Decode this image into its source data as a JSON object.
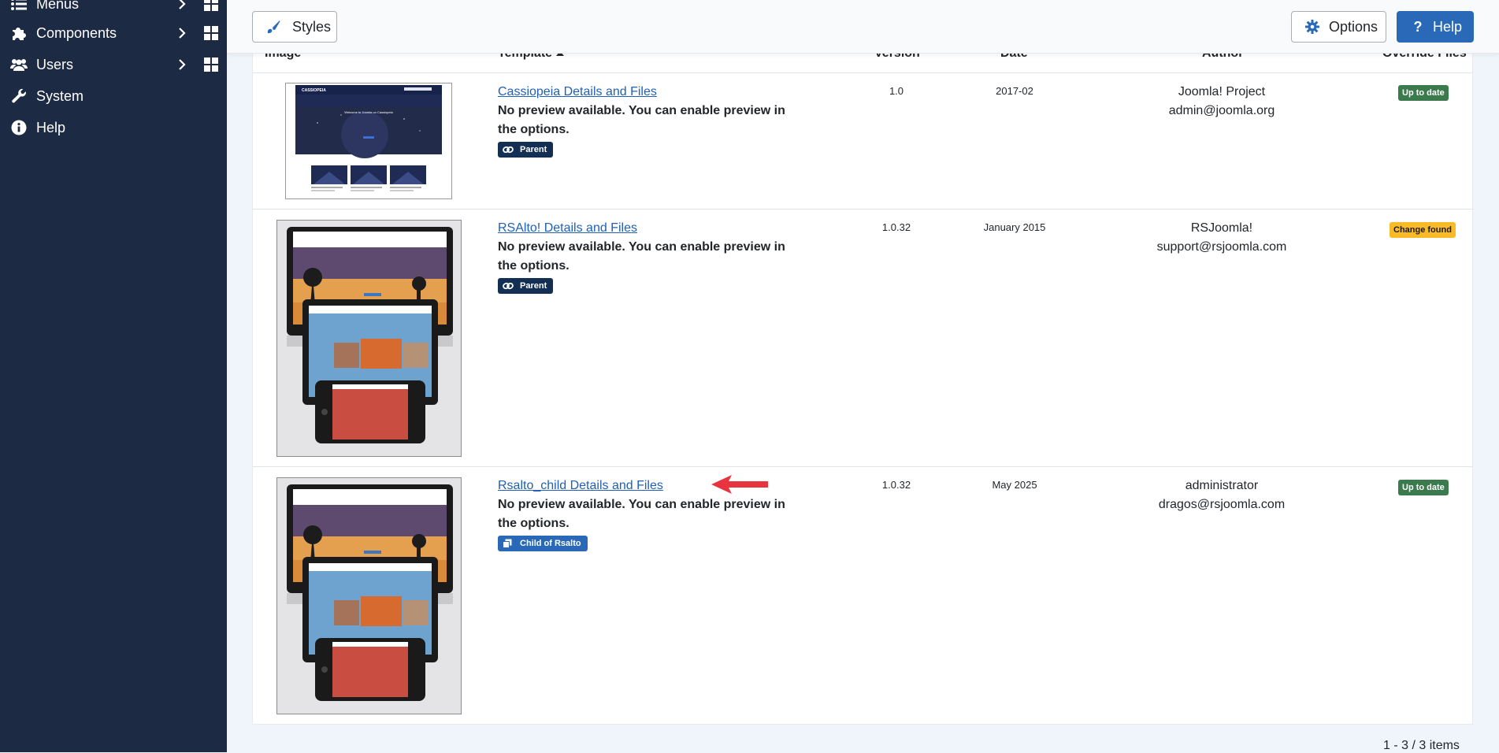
{
  "sidebar": {
    "items": [
      {
        "label": "Menus",
        "icon": "list-icon"
      },
      {
        "label": "Components",
        "icon": "puzzle-icon"
      },
      {
        "label": "Users",
        "icon": "users-icon"
      },
      {
        "label": "System",
        "icon": "wrench-icon"
      },
      {
        "label": "Help",
        "icon": "info-icon"
      }
    ]
  },
  "toolbar": {
    "styles_label": "Styles",
    "options_label": "Options",
    "help_label": "Help"
  },
  "table": {
    "headers": {
      "image": "Image",
      "template": "Template",
      "version": "Version",
      "date": "Date",
      "author": "Author",
      "override": "Override Files"
    },
    "rows": [
      {
        "title": "Cassiopeia Details and Files",
        "description": "No preview available. You can enable preview in the options.",
        "tag": "Parent",
        "version": "1.0",
        "date": "2017-02",
        "author_name": "Joomla! Project",
        "author_email": "admin@joomla.org",
        "override_status": "Up to date"
      },
      {
        "title": "RSAlto! Details and Files",
        "description": "No preview available. You can enable preview in the options.",
        "tag": "Parent",
        "version": "1.0.32",
        "date": "January 2015",
        "author_name": "RSJoomla!",
        "author_email": "support@rsjoomla.com",
        "override_status": "Change found"
      },
      {
        "title": "Rsalto_child Details and Files",
        "description": "No preview available. You can enable preview in the options.",
        "tag": "Child of Rsalto",
        "version": "1.0.32",
        "date": "May 2025",
        "author_name": "administrator",
        "author_email": "dragos@rsjoomla.com",
        "override_status": "Up to date"
      }
    ]
  },
  "thumbnail": {
    "cassiopeia_brand": "CASSIOPEIA",
    "cassiopeia_welcome": "Welcome to Joomla on Cassiopeia"
  },
  "pagination": {
    "summary": "1 - 3 / 3 items"
  },
  "colors": {
    "sidebar_bg": "#1c2a44",
    "primary": "#2a69b8",
    "link": "#2160b6",
    "badge_ok": "#3a7a4c",
    "badge_change": "#f9ba27",
    "tag_parent": "#132f53",
    "annotation_arrow": "#e8343e"
  }
}
